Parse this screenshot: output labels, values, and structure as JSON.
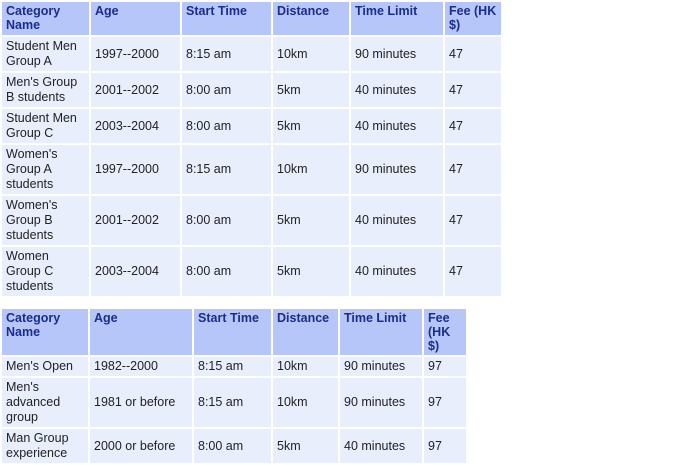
{
  "table1": {
    "headers": [
      "Category Name",
      "Age",
      "Start Time",
      "Distance",
      "Time Limit",
      "Fee (HK $)"
    ],
    "rows": [
      [
        "Student Men Group A",
        "1997--2000",
        "8:15 am",
        "10km",
        "90 minutes",
        "47"
      ],
      [
        "Men's Group B students",
        "2001--2002",
        "8:00 am",
        "5km",
        "40 minutes",
        "47"
      ],
      [
        "Student Men Group C",
        "2003--2004",
        "8:00 am",
        "5km",
        "40 minutes",
        "47"
      ],
      [
        "Women's Group A students",
        "1997--2000",
        "8:15 am",
        "10km",
        "90 minutes",
        "47"
      ],
      [
        "Women's Group B students",
        "2001--2002",
        "8:00 am",
        "5km",
        "40 minutes",
        "47"
      ],
      [
        "Women Group C students",
        "2003--2004",
        "8:00 am",
        "5km",
        "40 minutes",
        "47"
      ]
    ]
  },
  "table2": {
    "headers": [
      "Category Name",
      "Age",
      "Start Time",
      "Distance",
      "Time Limit",
      "Fee (HK $)"
    ],
    "rows": [
      [
        "Men's Open",
        "1982--2000",
        "8:15 am",
        "10km",
        "90 minutes",
        "97"
      ],
      [
        "Men's advanced group",
        "1981 or before",
        "8:15 am",
        "10km",
        "90 minutes",
        "97"
      ],
      [
        "Man Group experience",
        "2000 or before",
        "8:00 am",
        "5km",
        "40 minutes",
        "97"
      ]
    ]
  }
}
